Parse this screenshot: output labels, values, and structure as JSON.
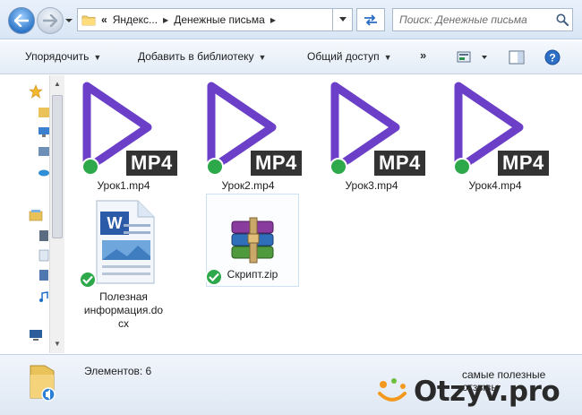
{
  "window": {
    "breadcrumb": {
      "overflow": "«",
      "items": [
        "Яндекс...",
        "Денежные письма"
      ]
    },
    "search": {
      "placeholder": "Поиск: Денежные письма"
    }
  },
  "toolbar": {
    "organize_label": "Упорядочить",
    "add_to_library_label": "Добавить в библиотеку",
    "share_label": "Общий доступ",
    "more_label": "»"
  },
  "files": [
    {
      "name": "Урок1.mp4",
      "type": "mp4",
      "badge": "MP4",
      "synced": true
    },
    {
      "name": "Урок2.mp4",
      "type": "mp4",
      "badge": "MP4",
      "synced": true
    },
    {
      "name": "Урок3.mp4",
      "type": "mp4",
      "badge": "MP4",
      "synced": true
    },
    {
      "name": "Урок4.mp4",
      "type": "mp4",
      "badge": "MP4",
      "synced": true
    },
    {
      "name_lines": [
        "Полезная",
        "информация.do",
        "cx"
      ],
      "type": "docx",
      "synced": true
    },
    {
      "name": "Скрипт.zip",
      "type": "zip",
      "synced": true
    }
  ],
  "status": {
    "items_count_text": "Элементов: 6"
  },
  "watermark": {
    "tagline": "самые полезные отзывы",
    "logo_text": "Otzyv.pro"
  },
  "colors": {
    "play_triangle": "#6b3fc8",
    "mp4_badge_bg": "#333333",
    "sync_check": "#2da84a",
    "logo_orange": "#f39a1e",
    "logo_green": "#6cbf3f"
  },
  "icons": {
    "back": "back-arrow-icon",
    "forward": "forward-arrow-icon",
    "search": "magnifier-icon",
    "refresh": "refresh-icon",
    "help": "help-icon",
    "view": "view-options-icon",
    "preview": "preview-pane-icon"
  }
}
